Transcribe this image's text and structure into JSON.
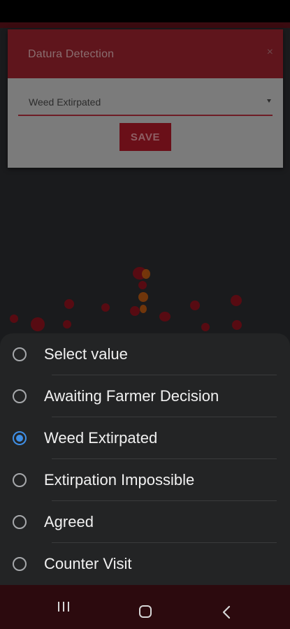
{
  "dialog": {
    "title": "Datura Detection",
    "close_glyph": "×",
    "select_value": "Weed Extirpated",
    "save_label": "SAVE"
  },
  "sheet": {
    "options": [
      {
        "label": "Select value",
        "checked": false
      },
      {
        "label": "Awaiting Farmer Decision",
        "checked": false
      },
      {
        "label": "Weed Extirpated",
        "checked": true
      },
      {
        "label": "Extirpation Impossible",
        "checked": false
      },
      {
        "label": "Agreed",
        "checked": false
      },
      {
        "label": "Counter Visit",
        "checked": false
      }
    ]
  },
  "colors": {
    "accent": "#3f8fe6",
    "brand": "#c0152a"
  },
  "icons": {
    "close": "close-icon",
    "dropdown": "dropdown-arrow-icon",
    "recents": "recents-icon",
    "home": "home-icon",
    "back": "back-icon"
  }
}
